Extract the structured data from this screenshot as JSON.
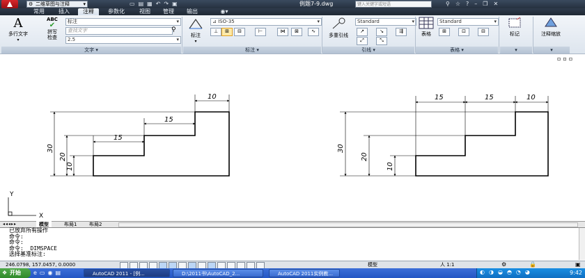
{
  "titlebar": {
    "workspace": "二维草图与注释",
    "title": "例题7-9.dwg",
    "search_placeholder": "键入关键字或短语"
  },
  "tabs": [
    "常用",
    "插入",
    "注释",
    "参数化",
    "视图",
    "管理",
    "输出"
  ],
  "ribbon": {
    "text_panel": {
      "mtext_label": "多行文字",
      "spell_label": "拼写检查",
      "abc": "ABC",
      "style_value": "标注",
      "find_placeholder": "查找文字",
      "height_value": "2.5",
      "panel_label": "文字"
    },
    "dim_panel": {
      "dim_label": "标注",
      "style_value": "ISO-35",
      "panel_label": "标注"
    },
    "leader_panel": {
      "leader_label": "多重引线",
      "style_value": "Standard",
      "panel_label": "引线"
    },
    "table_panel": {
      "table_label": "表格",
      "style_value": "Standard",
      "panel_label": "表格"
    },
    "markup_panel": {
      "mark_label": "标记"
    },
    "scale_panel": {
      "scale_label": "注释缩放"
    }
  },
  "drawing": {
    "left": {
      "dims": [
        "10",
        "15",
        "15",
        "30",
        "20",
        "10"
      ]
    },
    "right": {
      "dims": [
        "15",
        "15",
        "10",
        "30",
        "20",
        "10"
      ]
    },
    "ucs_x": "X",
    "ucs_y": "Y"
  },
  "layout_tabs": [
    "模型",
    "布局1",
    "布局2"
  ],
  "command_lines": [
    "已放弃所有操作",
    "命令:",
    "命令:",
    "命令: _DIMSPACE",
    "选择基准标注:"
  ],
  "status": {
    "coords": "246.0798, 157.0457, 0.0000",
    "model": "模型",
    "scale": "人 1:1"
  },
  "taskbar": {
    "start": "开始",
    "tasks": [
      "AutoCAD 2011 - [例...",
      "D:\\2011书\\AutoCAD_2...",
      "AutoCAD 2011实例教..."
    ],
    "clock": "9:42"
  },
  "colors": {
    "accent": "#2456c4",
    "ribbon_dark": "#26313f"
  }
}
